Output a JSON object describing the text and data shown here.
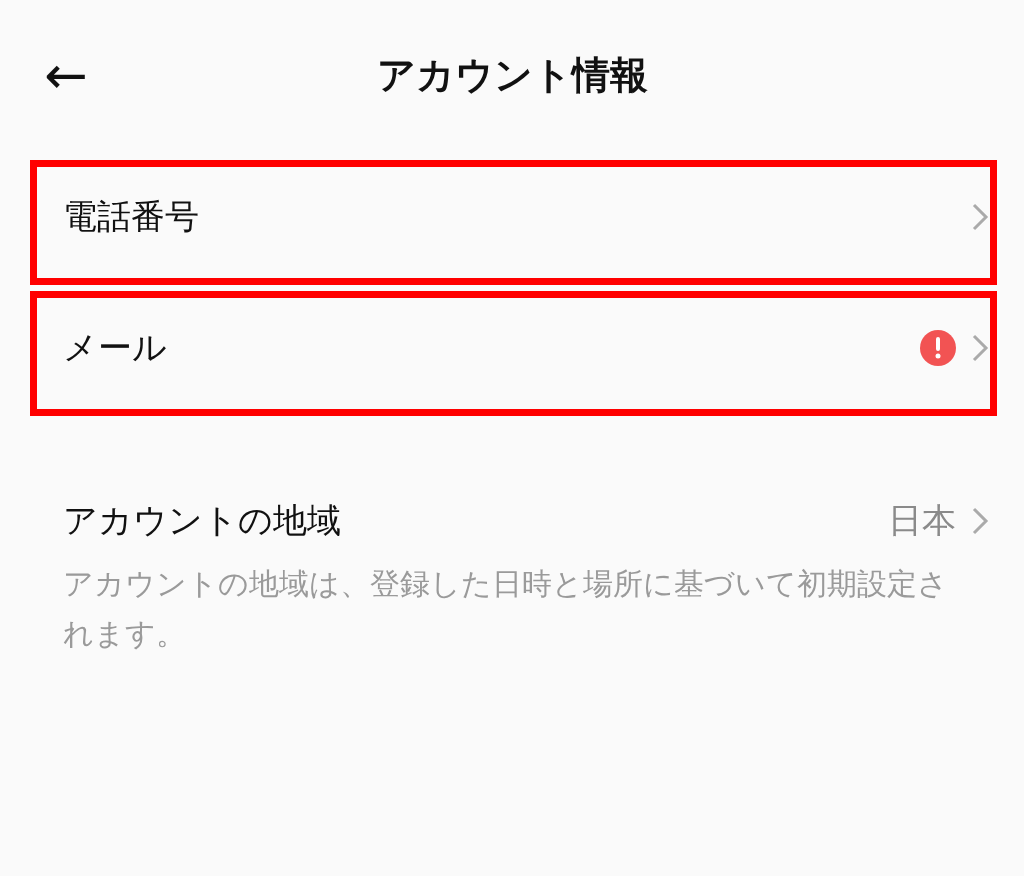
{
  "header": {
    "back": "←",
    "title": "アカウント情報"
  },
  "rows": [
    {
      "label": "電話番号",
      "alert": false,
      "highlighted": true
    },
    {
      "label": "メール",
      "alert": true,
      "highlighted": true
    },
    {
      "label": "アカウントの地域",
      "value": "日本",
      "alert": false,
      "highlighted": false,
      "description": "アカウントの地域は、登録した日時と場所に基づいて初期設定されます。"
    }
  ]
}
